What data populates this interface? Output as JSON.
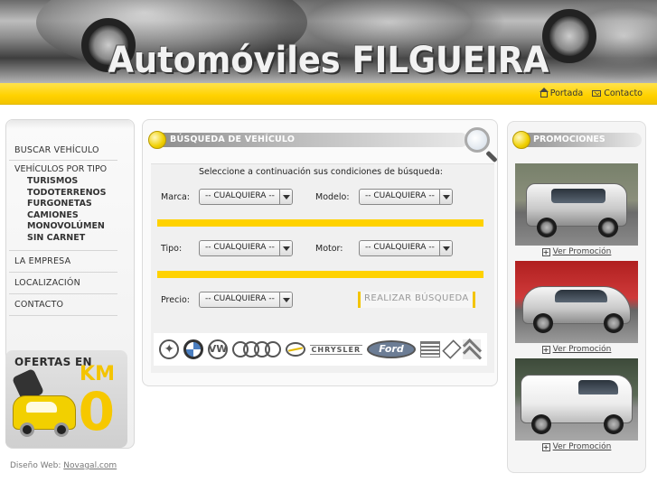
{
  "header": {
    "site_title": "Automóviles FILGUEIRA"
  },
  "topnav": {
    "items": [
      {
        "icon": "home-icon",
        "label": "Portada"
      },
      {
        "icon": "mail-icon",
        "label": "Contacto"
      }
    ]
  },
  "sidebar": {
    "items": [
      {
        "label": "BUSCAR VEHÍCULO"
      },
      {
        "label": "VEHÍCULOS POR TIPO",
        "subitems": [
          "TURISMOS",
          "TODOTERRENOS",
          "FURGONETAS",
          "CAMIONES",
          "MONOVOLÚMEN",
          "SIN CARNET"
        ]
      },
      {
        "label": "LA EMPRESA"
      },
      {
        "label": "LOCALIZACIÓN"
      },
      {
        "label": "CONTACTO"
      }
    ],
    "km0_banner": {
      "line1": "OFERTAS EN",
      "line2": "KM",
      "line3": "0"
    }
  },
  "footer": {
    "credit_prefix": "Diseño Web:",
    "credit_link": "Novagal.com"
  },
  "search": {
    "title": "BÚSQUEDA DE VEHÍCULO",
    "instructions": "Seleccione a continuación sus condiciones de búsqueda:",
    "fields": {
      "marca": {
        "label": "Marca:",
        "value": "-- CUALQUIERA --"
      },
      "modelo": {
        "label": "Modelo:",
        "value": "-- CUALQUIERA --"
      },
      "tipo": {
        "label": "Tipo:",
        "value": "-- CUALQUIERA --"
      },
      "motor": {
        "label": "Motor:",
        "value": "-- CUALQUIERA --"
      },
      "precio": {
        "label": "Precio:",
        "value": "-- CUALQUIERA --"
      }
    },
    "submit_label": "REALIZAR BÚSQUEDA",
    "brands": [
      "mercedes-logo",
      "bmw-logo",
      "volkswagen-logo",
      "audi-logo",
      "opel-logo",
      "chrysler-logo",
      "ford-logo",
      "seat-logo",
      "renault-logo",
      "citroen-logo"
    ],
    "brand_text": {
      "vw": "VW",
      "chrysler": "CHRYSLER",
      "ford": "Ford"
    }
  },
  "promotions": {
    "title": "PROMOCIONES",
    "items": [
      {
        "link_label": "Ver Promoción"
      },
      {
        "link_label": "Ver Promoción"
      },
      {
        "link_label": "Ver Promoción"
      }
    ]
  },
  "colors": {
    "accent_yellow": "#ffd200",
    "heading_gray": "#8a8a8a"
  }
}
